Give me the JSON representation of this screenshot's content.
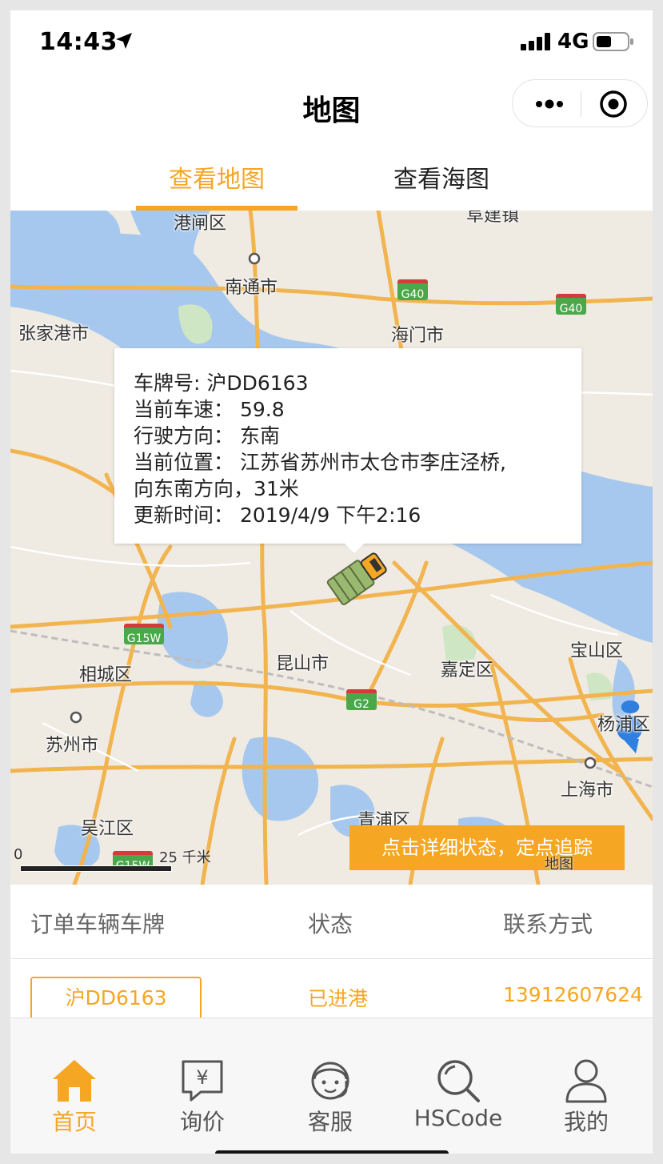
{
  "status_bar": {
    "time": "14:43",
    "network": "4G"
  },
  "nav": {
    "title": "地图"
  },
  "tabs": [
    {
      "label": "查看地图",
      "active": true
    },
    {
      "label": "查看海图",
      "active": false
    }
  ],
  "map": {
    "labels": {
      "gangzha": "港闸区",
      "fujian": "阜建镇",
      "nantong": "南通市",
      "zhangjiagang": "张家港市",
      "haimen": "海门市",
      "xiangcheng": "相城区",
      "kunshan": "昆山市",
      "jiading": "嘉定区",
      "baoshan": "宝山区",
      "yangpu": "杨浦区",
      "suzhou": "苏州市",
      "shanghai": "上海市",
      "wujiang": "吴江区",
      "qingpu": "青浦区"
    },
    "shields": {
      "g40a": "G40",
      "g40b": "G40",
      "g15w": "G15W",
      "g2": "G2",
      "g15w2": "G15W"
    },
    "popup": {
      "plate": "车牌号: 沪DD6163",
      "speed": "当前车速：  59.8",
      "direction": "行驶方向：  东南",
      "location_1": "当前位置：  江苏省苏州市太仓市李庄泾桥,",
      "location_2": "向东南方向，31米",
      "updated": "更新时间：  2019/4/9 下午2:16"
    },
    "track_button": "点击详细状态，定点追踪",
    "scale": {
      "zero": "0",
      "label": "25 千米"
    },
    "attribution": "地图",
    "colors": {
      "land": "#efeae2",
      "water": "#a7c8ee",
      "road": "#f2b44f",
      "park": "#cfe6c4"
    }
  },
  "table": {
    "headers": {
      "plate": "订单车辆车牌",
      "status": "状态",
      "contact": "联系方式"
    },
    "rows": [
      {
        "plate": "沪DD6163",
        "status": "已进港",
        "contact": "13912607624"
      }
    ]
  },
  "tabbar": [
    {
      "label": "首页",
      "icon": "home-icon",
      "active": true
    },
    {
      "label": "询价",
      "icon": "yen-quote-icon",
      "active": false
    },
    {
      "label": "客服",
      "icon": "customer-service-icon",
      "active": false
    },
    {
      "label": "HSCode",
      "icon": "search-icon",
      "active": false
    },
    {
      "label": "我的",
      "icon": "user-icon",
      "active": false
    }
  ],
  "accent": "#f5a623"
}
